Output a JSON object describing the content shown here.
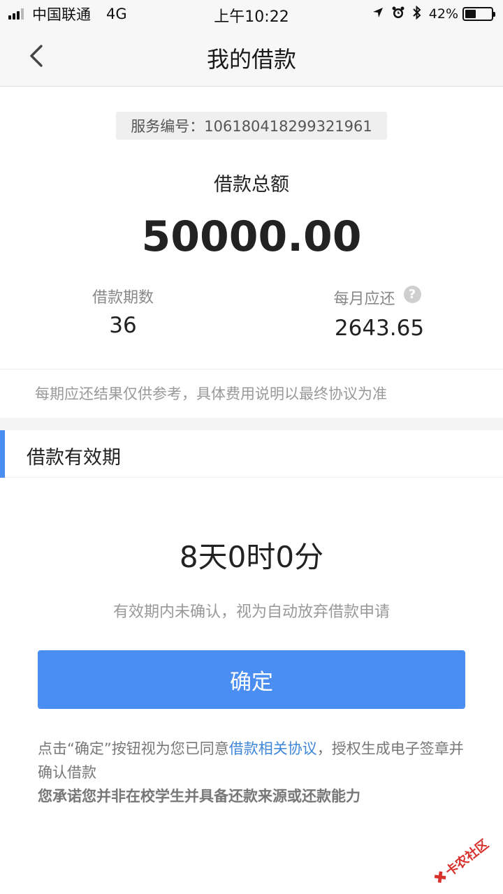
{
  "status_bar": {
    "carrier": "中国联通",
    "network": "4G",
    "time": "上午10:22",
    "battery_percent": "42%",
    "battery_level": 0.42
  },
  "nav": {
    "title": "我的借款"
  },
  "loan": {
    "service_no": "服务编号：106180418299321961",
    "total_label": "借款总额",
    "total_value": "50000.00",
    "term_label": "借款期数",
    "term_value": "36",
    "monthly_label": "每月应还",
    "monthly_help_glyph": "?",
    "monthly_value": "2643.65",
    "note": "每期应还结果仅供参考，具体费用说明以最终协议为准"
  },
  "validity": {
    "section_title": "借款有效期",
    "countdown": "8天0时0分",
    "note": "有效期内未确认，视为自动放弃借款申请"
  },
  "actions": {
    "confirm_label": "确定"
  },
  "agreement": {
    "prefix": "点击“确定”按钮视为您已同意",
    "link": "借款相关协议",
    "suffix": "，授权生成电子签章并确认借款",
    "promise": "您承诺您并非在校学生并具备还款来源或还款能力"
  },
  "watermark": {
    "text": "卡农社区"
  },
  "colors": {
    "accent": "#4b8ef1",
    "link": "#3d86d8",
    "muted_text": "#999999"
  }
}
